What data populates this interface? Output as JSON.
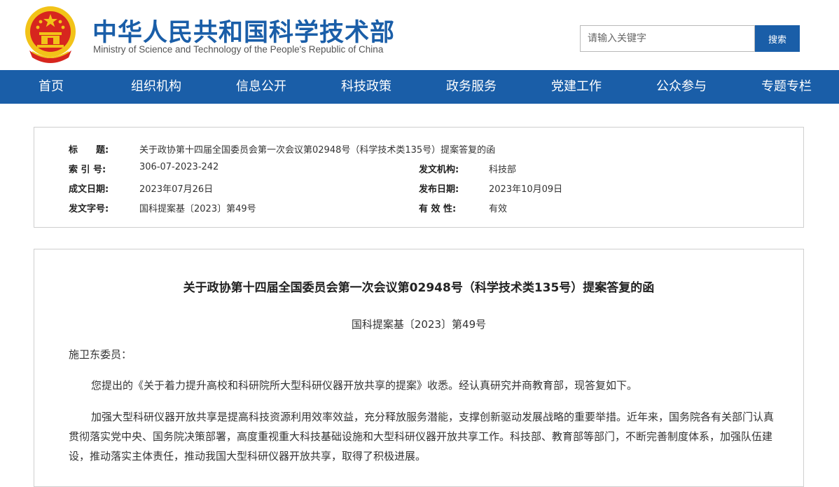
{
  "header": {
    "title": "中华人民共和国科学技术部",
    "subtitle": "Ministry of Science and Technology of the People's Republic of China",
    "search_placeholder": "请输入关键字",
    "search_button": "搜索",
    "emblem_icon": "national-emblem-icon"
  },
  "nav": {
    "items": [
      "首页",
      "组织机构",
      "信息公开",
      "科技政策",
      "政务服务",
      "党建工作",
      "公众参与",
      "专题专栏"
    ]
  },
  "meta": {
    "title_label": "标　　题:",
    "title_value": "关于政协第十四届全国委员会第一次会议第02948号（科学技术类135号）提案答复的函",
    "index_label": "索 引 号:",
    "index_value": "306-07-2023-242",
    "issuer_label": "发文机构:",
    "issuer_value": "科技部",
    "written_label": "成文日期:",
    "written_value": "2023年07月26日",
    "published_label": "发布日期:",
    "published_value": "2023年10月09日",
    "docno_label": "发文字号:",
    "docno_value": "国科提案基〔2023〕第49号",
    "validity_label": "有 效 性:",
    "validity_value": "有效"
  },
  "article": {
    "title": "关于政协第十四届全国委员会第一次会议第02948号（科学技术类135号）提案答复的函",
    "doc_number": "国科提案基〔2023〕第49号",
    "salutation": "施卫东委员：",
    "paragraphs": [
      "您提出的《关于着力提升高校和科研院所大型科研仪器开放共享的提案》收悉。经认真研究并商教育部，现答复如下。",
      "加强大型科研仪器开放共享是提高科技资源利用效率效益，充分释放服务潜能，支撑创新驱动发展战略的重要举措。近年来，国务院各有关部门认真贯彻落实党中央、国务院决策部署，高度重视重大科技基础设施和大型科研仪器开放共享工作。科技部、教育部等部门，不断完善制度体系，加强队伍建设，推动落实主体责任，推动我国大型科研仪器开放共享，取得了积极进展。"
    ]
  },
  "colors": {
    "brand_blue": "#1a5ea8",
    "emblem_red": "#d7261e",
    "emblem_gold": "#f2c318"
  }
}
